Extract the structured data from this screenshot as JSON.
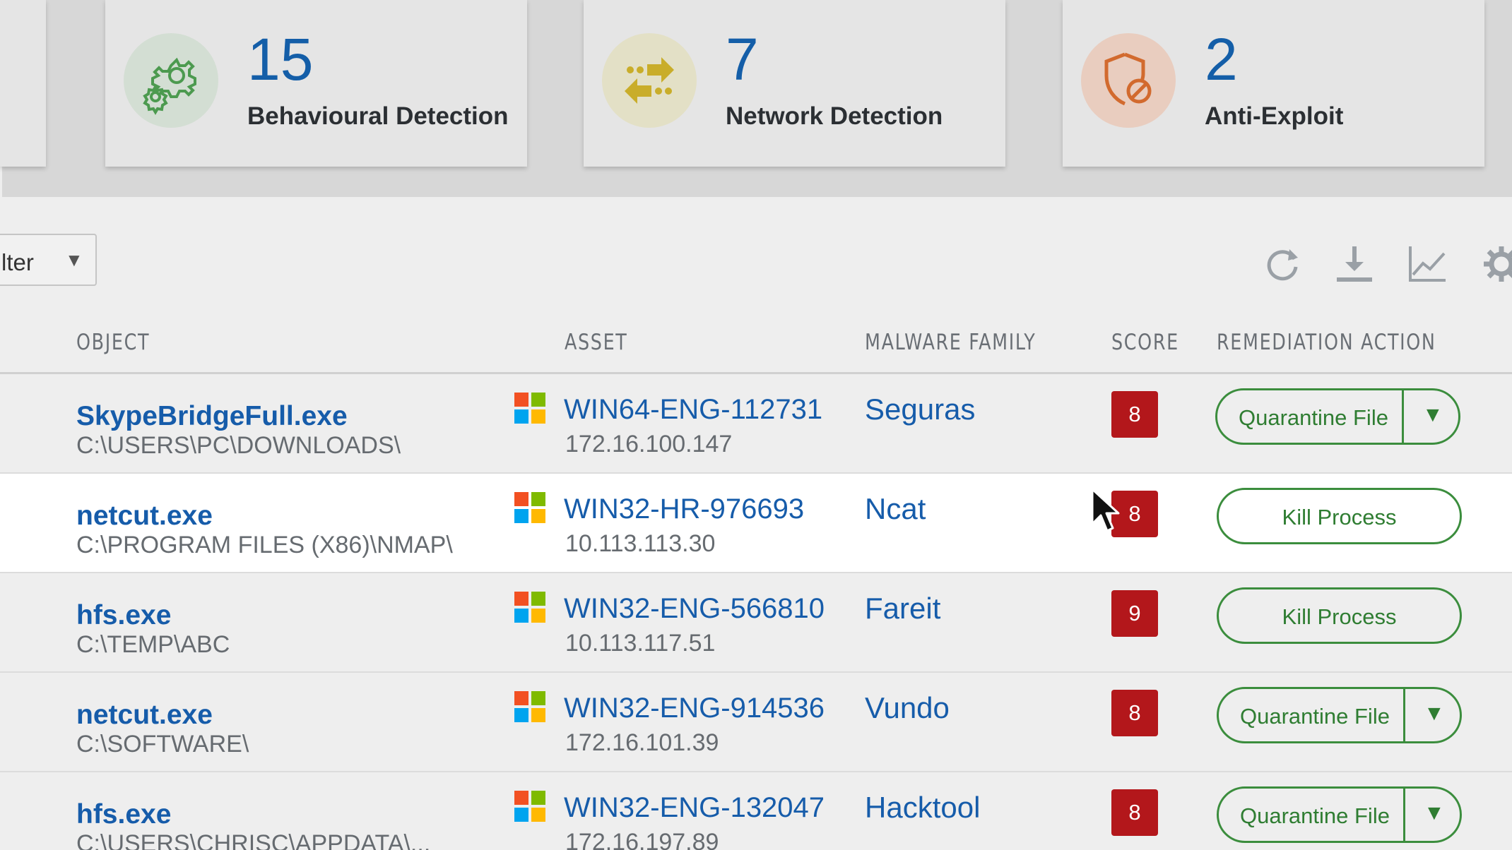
{
  "summary": {
    "cards": [
      {
        "count": "15",
        "label": "Behavioural Detection",
        "icon": "gears-icon",
        "color": "#d3ded3"
      },
      {
        "count": "7",
        "label": "Network Detection",
        "icon": "transfer-arrows-icon",
        "color": "#e3e0c6"
      },
      {
        "count": "2",
        "label": "Anti-Exploit",
        "icon": "shield-block-icon",
        "color": "#e9cdbf"
      }
    ]
  },
  "toolbar": {
    "filter_label": "lter",
    "filter_caret": "▼",
    "icons": [
      "refresh-icon",
      "download-icon",
      "chart-icon",
      "settings-icon"
    ]
  },
  "table": {
    "headers": {
      "object": "OBJECT",
      "asset": "ASSET",
      "family": "MALWARE FAMILY",
      "score": "SCORE",
      "action": "REMEDIATION ACTION"
    },
    "rows": [
      {
        "name": "SkypeBridgeFull.exe",
        "path": "C:\\USERS\\PC\\DOWNLOADS\\",
        "asset": "WIN64-ENG-112731",
        "ip": "172.16.100.147",
        "family": "Seguras",
        "score": "8",
        "action": "Quarantine File",
        "split": true
      },
      {
        "name": "netcut.exe",
        "path": "C:\\PROGRAM FILES (X86)\\NMAP\\",
        "asset": "WIN32-HR-976693",
        "ip": "10.113.113.30",
        "family": "Ncat",
        "score": "8",
        "action": "Kill Process",
        "split": false
      },
      {
        "name": "hfs.exe",
        "path": "C:\\TEMP\\ABC",
        "asset": "WIN32-ENG-566810",
        "ip": "10.113.117.51",
        "family": "Fareit",
        "score": "9",
        "action": "Kill Process",
        "split": false
      },
      {
        "name": "netcut.exe",
        "path": "C:\\SOFTWARE\\",
        "asset": "WIN32-ENG-914536",
        "ip": "172.16.101.39",
        "family": "Vundo",
        "score": "8",
        "action": "Quarantine File",
        "split": true
      },
      {
        "name": "hfs.exe",
        "path": "C:\\USERS\\CHRISC\\APPDATA\\...",
        "asset": "WIN32-ENG-132047",
        "ip": "172.16.197.89",
        "family": "Hacktool",
        "score": "8",
        "action": "Quarantine File",
        "split": true
      }
    ],
    "caret": "▼"
  },
  "colors": {
    "link_blue": "#165caa",
    "score_red": "#b3171b",
    "action_green": "#3b8d3d",
    "row_highlight": "#ffffff"
  }
}
